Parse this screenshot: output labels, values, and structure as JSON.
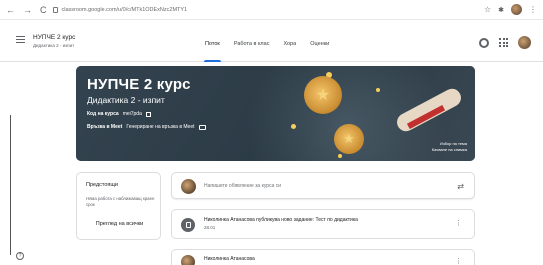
{
  "browser": {
    "back_glyph": "←",
    "forward_glyph": "→",
    "reload_glyph": "C",
    "url": "classroom.google.com/u/0/c/MTk1ODExNzc2MTY1",
    "star_glyph": "☆"
  },
  "header": {
    "class_name": "НУПЧЕ 2 курс",
    "class_section": "Дидактика 2 - изпит",
    "tabs": [
      {
        "label": "Поток",
        "active": true
      },
      {
        "label": "Работа в клас",
        "active": false
      },
      {
        "label": "Хора",
        "active": false
      },
      {
        "label": "Оценки",
        "active": false
      }
    ]
  },
  "banner": {
    "title": "НУПЧЕ 2 курс",
    "subtitle": "Дидактика 2 - изпит",
    "code_label": "Код на курса",
    "code_value": "mei7pda",
    "meet_label": "Връзка в Meet",
    "meet_value": "Генериране на връзка в Meet",
    "theme_link_line1": "Избор на тема",
    "theme_link_line2": "Качване на снимка",
    "colors": {
      "background": "#2f3f4a",
      "accent": "#f6cf5a"
    }
  },
  "upcoming": {
    "title": "Предстоящи",
    "text": "Няма работа с наближаващ краен срок",
    "view_all": "Преглед на всички"
  },
  "stream": {
    "announce_placeholder": "Напишете обявление за курса си",
    "posts": [
      {
        "text": "Николинка Атанасова публикува ново задание: Тест по дидактика",
        "date": "28.01"
      },
      {
        "text": "Николинка Атанасова",
        "date": ""
      }
    ]
  },
  "help_glyph": "?",
  "accent_color": "#1e6fd9"
}
